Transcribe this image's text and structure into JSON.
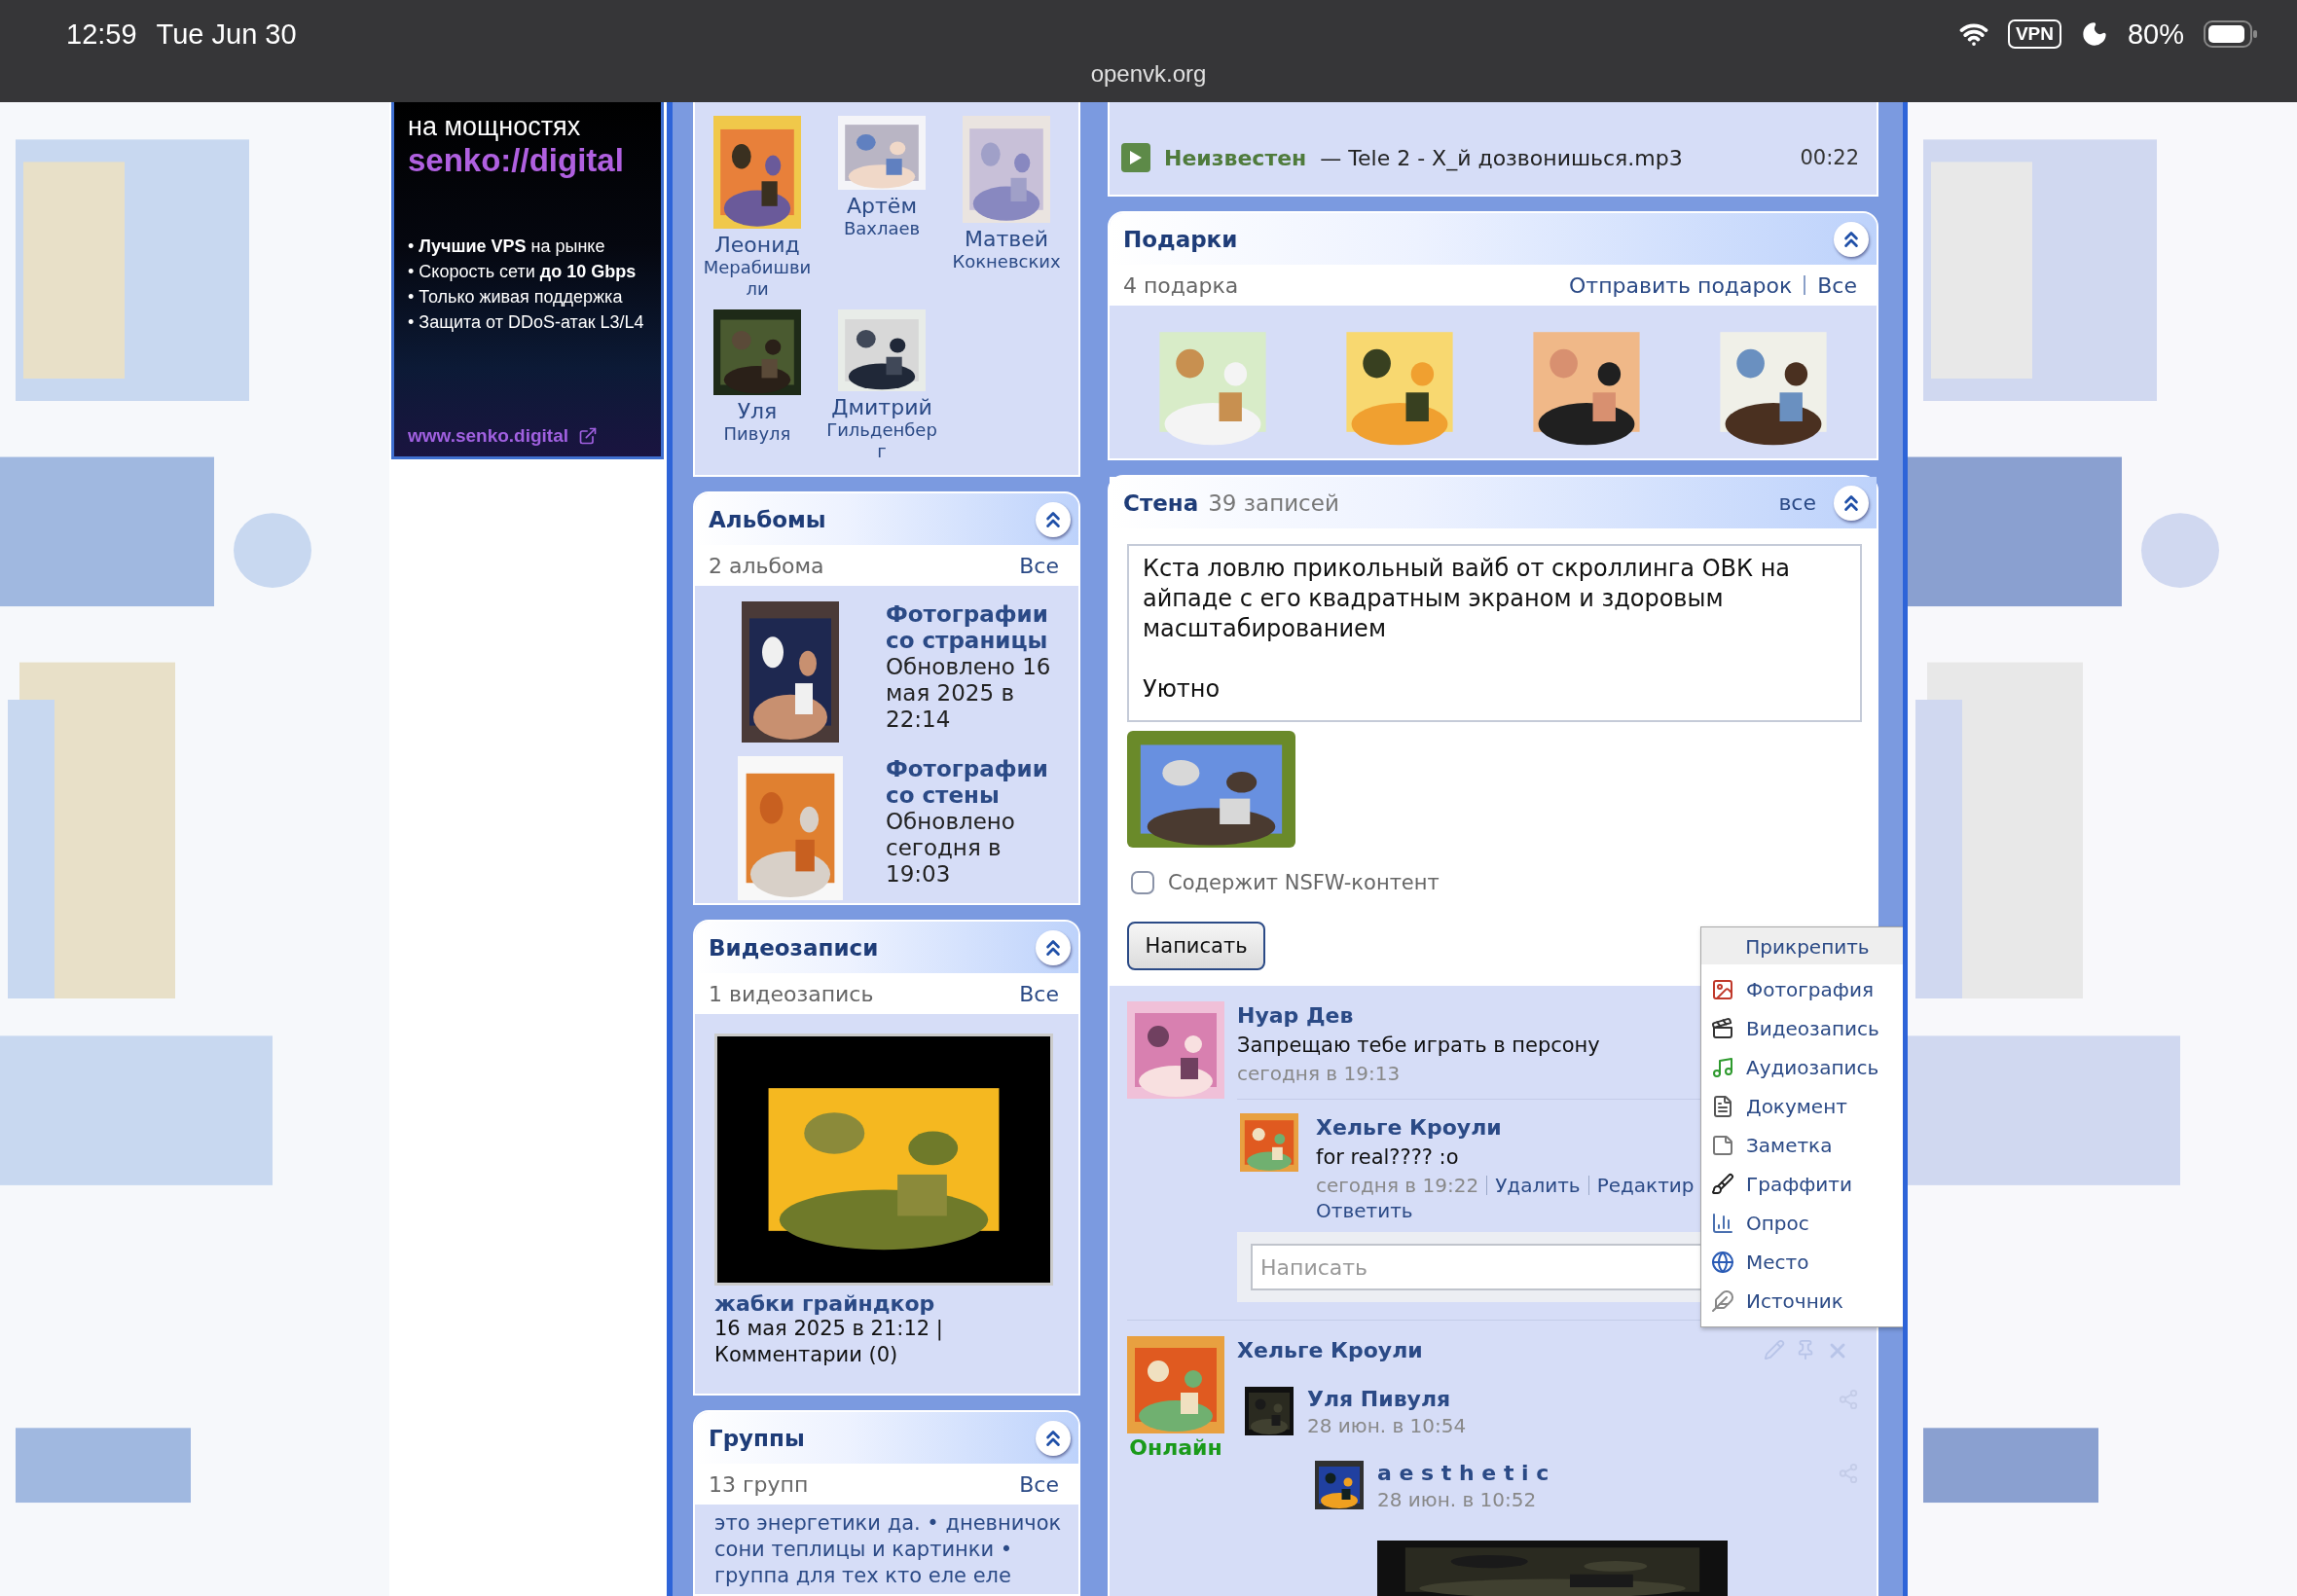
{
  "status_bar": {
    "time": "12:59",
    "date": "Tue Jun 30",
    "url": "openvk.org",
    "vpn": "VPN",
    "battery": "80%"
  },
  "ad": {
    "line": "на мощностях",
    "brand": "senko://digital",
    "bullets": [
      "• **Лучшие VPS** на рынке",
      "• Скорость сети **до 10 Gbps**",
      "• Только живая поддержка",
      "• Защита от DDoS-атак L3/L4"
    ],
    "url": "www.senko.digital"
  },
  "friends": [
    {
      "first": "Леонид",
      "last": "Мерабишвили"
    },
    {
      "first": "Артём",
      "last": "Вахлаев"
    },
    {
      "first": "Матвей",
      "last": "Кокневских"
    },
    {
      "first": "Уля",
      "last": "Пивуля"
    },
    {
      "first": "Дмитрий",
      "last": "Гильденберг"
    }
  ],
  "albums": {
    "title": "Альбомы",
    "count": "2 альбома",
    "all": "Все",
    "items": [
      {
        "title": "Фотографии со страницы",
        "updated": "Обновлено 16 мая 2025 в 22:14"
      },
      {
        "title": "Фотографии со стены",
        "updated": "Обновлено сегодня в 19:03"
      }
    ]
  },
  "videos": {
    "title": "Видеозаписи",
    "count": "1 видеозапись",
    "all": "Все",
    "items": [
      {
        "title": "жабки грайндкор",
        "date": "16 мая 2025 в 21:12 |",
        "comments": "Комментарии (0)"
      }
    ]
  },
  "groups": {
    "title": "Группы",
    "count": "13 групп",
    "all": "Все",
    "text": "это энергетики да. • дневничок сони теплицы и картинки • группа для тех кто еле еле"
  },
  "audio": {
    "artist": "Неизвестен",
    "title": "— Tele 2 - Х_й дозвонишься.mp3",
    "duration": "00:22"
  },
  "gifts": {
    "title": "Подарки",
    "count": "4 подарка",
    "send": "Отправить подарок",
    "all": "Все"
  },
  "wall": {
    "title": "Стена",
    "count": "39 записей",
    "all": "все",
    "composer": {
      "text": "Кста ловлю прикольный вайб от скроллинга ОВК на айпаде с его квадратным экраном и здоровым масштабированием\n\nУютно",
      "nsfw": {
        "label": "Содержит NSFW-контент",
        "checked": false
      },
      "submit": "Написать"
    },
    "attach_menu": {
      "title": "Прикрепить",
      "items": [
        {
          "label": "Фотография"
        },
        {
          "label": "Видеозапись",
          "kind": "video"
        },
        {
          "label": "Аудиозапись",
          "kind": "audio"
        },
        {
          "label": "Документ",
          "kind": "document"
        },
        {
          "label": "Заметка",
          "kind": "note"
        },
        {
          "label": "Граффити",
          "kind": "graffiti"
        },
        {
          "label": "Опрос",
          "kind": "poll"
        },
        {
          "label": "Место",
          "kind": "place"
        },
        {
          "label": "Источник",
          "kind": "source"
        }
      ]
    },
    "posts": [
      {
        "author": "Нуар Дев",
        "text": "Запрещаю тебе играть в персону",
        "time": "сегодня в 19:13",
        "comments": [
          {
            "author": "Хельге Кроули",
            "text": "for real???? :o",
            "time": "сегодня в 19:22",
            "actions": [
              "Удалить",
              "Редактир"
            ],
            "reply": "Ответить"
          }
        ],
        "comment_placeholder": "Написать"
      },
      {
        "author": "Хельге Кроули",
        "status": "Онлайн",
        "repost": {
          "author": "Уля Пивуля",
          "time": "28 июн. в 10:54",
          "repost": {
            "author": "a e s t h e t i c",
            "time": "28 июн. в 10:52"
          }
        }
      }
    ]
  }
}
